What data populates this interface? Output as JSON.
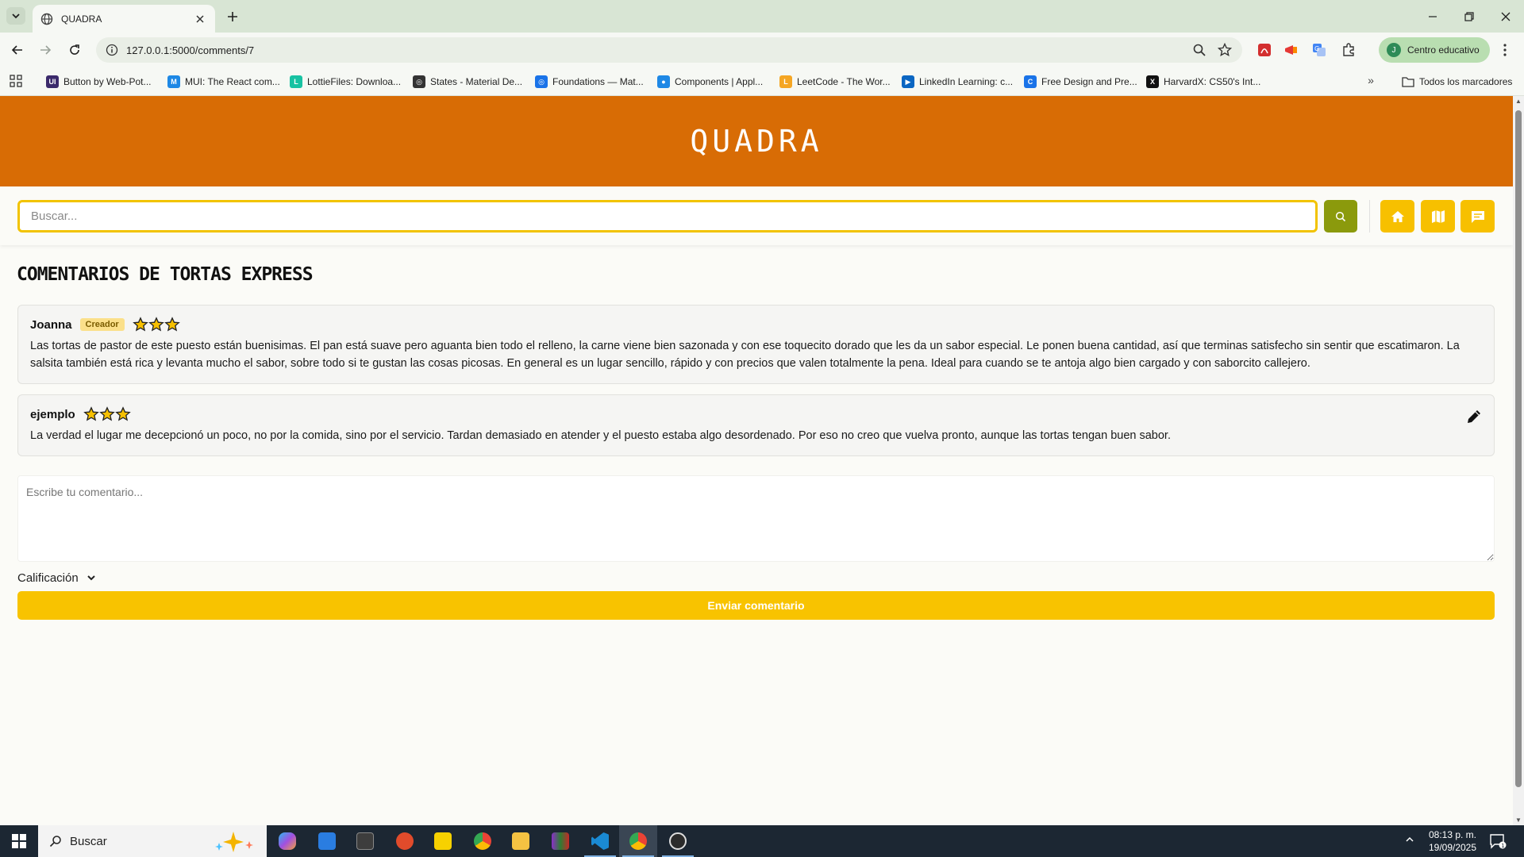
{
  "browser": {
    "tab_title": "QUADRA",
    "url": "127.0.0.1:5000/comments/7",
    "profile_label": "Centro educativo",
    "profile_initial": "J",
    "bookmarks": [
      {
        "label": "Button by Web-Pot...",
        "icon": "ui-icon",
        "color": "#3b2a6b",
        "glyph": "UI"
      },
      {
        "label": "MUI: The React com...",
        "icon": "mui-icon",
        "color": "#1e88e5",
        "glyph": "M"
      },
      {
        "label": "LottieFiles: Downloa...",
        "icon": "lottie-icon",
        "color": "#18c2a2",
        "glyph": "L"
      },
      {
        "label": "States - Material De...",
        "icon": "material-icon",
        "color": "#333333",
        "glyph": "◎"
      },
      {
        "label": "Foundations — Mat...",
        "icon": "material-icon",
        "color": "#1a73e8",
        "glyph": "◎"
      },
      {
        "label": "Components | Appl...",
        "icon": "apple-icon",
        "color": "#1e88e5",
        "glyph": "●"
      },
      {
        "label": "LeetCode - The Wor...",
        "icon": "leetcode-icon",
        "color": "#f5a623",
        "glyph": "L"
      },
      {
        "label": "LinkedIn Learning: c...",
        "icon": "linkedin-icon",
        "color": "#0a66c2",
        "glyph": "▶"
      },
      {
        "label": "Free Design and Pre...",
        "icon": "canva-icon",
        "color": "#1a73e8",
        "glyph": "C"
      },
      {
        "label": "HarvardX: CS50's Int...",
        "icon": "edx-icon",
        "color": "#111111",
        "glyph": "X"
      }
    ],
    "all_bookmarks_label": "Todos los marcadores"
  },
  "app": {
    "brand": "QUADRA",
    "search_placeholder": "Buscar...",
    "page_title": "COMENTARIOS DE TORTAS EXPRESS",
    "colors": {
      "header": "#d86c05",
      "accent": "#f7c000",
      "search_button": "#8b9a0c"
    }
  },
  "comments": [
    {
      "author": "Joanna",
      "badge": "Creador",
      "rating": 3,
      "editable": false,
      "text": "Las tortas de pastor de este puesto están buenisimas. El pan está suave pero aguanta bien todo el relleno, la carne viene bien sazonada y con ese toquecito dorado que les da un sabor especial. Le ponen buena cantidad, así que terminas satisfecho sin sentir que escatimaron. La salsita también está rica y levanta mucho el sabor, sobre todo si te gustan las cosas picosas. En general es un lugar sencillo, rápido y con precios que valen totalmente la pena. Ideal para cuando se te antoja algo bien cargado y con saborcito callejero."
    },
    {
      "author": "ejemplo",
      "badge": "",
      "rating": 3,
      "editable": true,
      "text": "La verdad el lugar me decepcionó un poco, no por la comida, sino por el servicio. Tardan demasiado en atender y el puesto estaba algo desordenado. Por eso no creo que vuelva pronto, aunque las tortas tengan buen sabor."
    }
  ],
  "form": {
    "comment_placeholder": "Escribe tu comentario...",
    "rating_label": "Calificación",
    "submit_label": "Enviar comentario"
  },
  "taskbar": {
    "search_label": "Buscar",
    "time": "08:13 p. m.",
    "date": "19/09/2025",
    "notifications": "1"
  }
}
